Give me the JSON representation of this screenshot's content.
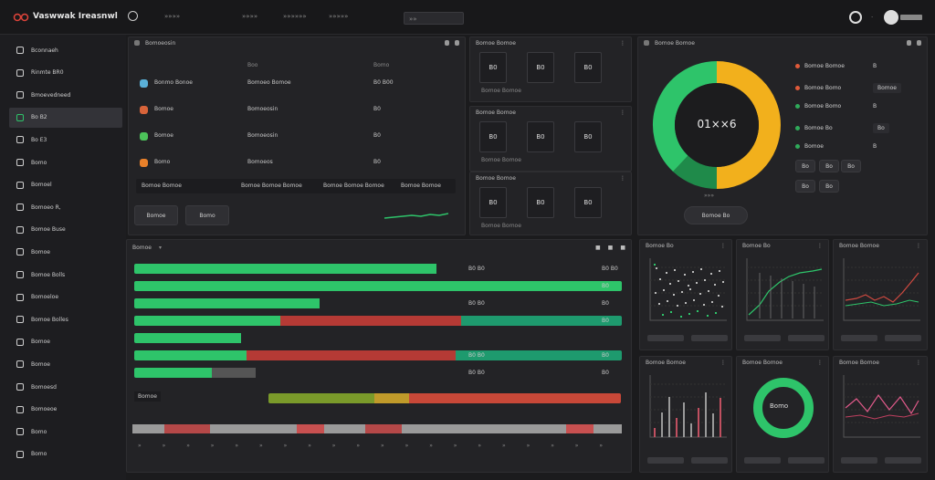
{
  "app": {
    "title": "Vaswwak Ireasnwl",
    "menu": [
      "»»»»",
      "»»»»",
      "»»»»»»",
      "»»»»»"
    ],
    "dropdown_value": "»»"
  },
  "sidebar": {
    "items": [
      {
        "label": "Bconnaeh",
        "icon": "grid-icon"
      },
      {
        "label": "Rinmte BR0",
        "icon": "monitor-icon"
      },
      {
        "label": "Bmoevedneed",
        "icon": "chip-icon"
      },
      {
        "label": "Bo B2",
        "icon": "database-icon",
        "active": true
      },
      {
        "label": "Bo E3",
        "icon": "chart-icon"
      },
      {
        "label": "Bomo",
        "icon": "cube-icon"
      },
      {
        "label": "Bomoel",
        "icon": "network-icon"
      },
      {
        "label": "Bomoeo R,",
        "icon": "file-icon"
      },
      {
        "label": "Bomoe Buse",
        "icon": "clock-icon"
      },
      {
        "label": "Bomoe",
        "icon": "stack-icon"
      },
      {
        "label": "Bomoe Bolls",
        "icon": "link-icon"
      },
      {
        "label": "Bomoeloe",
        "icon": "bell-icon"
      },
      {
        "label": "Bomoe Bolles",
        "icon": "list-icon"
      },
      {
        "label": "Bomoe",
        "icon": "folder-icon"
      },
      {
        "label": "Bomoe",
        "icon": "shield-icon"
      },
      {
        "label": "Bomoesd",
        "icon": "gear-icon"
      },
      {
        "label": "Bomoeoe",
        "icon": "user-icon"
      },
      {
        "label": "Bomo",
        "icon": "layers-icon"
      },
      {
        "label": "Bomo",
        "icon": "power-icon"
      }
    ]
  },
  "table_panel": {
    "title": "Bomoeosin",
    "columns": [
      "Boo",
      "Bomo"
    ],
    "rows": [
      {
        "name": "Bonmo Bonoe",
        "mid": "Bomoeo Bomoe",
        "val": "B0 B00",
        "color": "#5ab0d8"
      },
      {
        "name": "Bomoe",
        "mid": "Bomoeosin",
        "val": "B0",
        "color": "#d8643a"
      },
      {
        "name": "Bomoe",
        "mid": "Bomoeosin",
        "val": "B0",
        "color": "#4cc25a"
      },
      {
        "name": "Bomo",
        "mid": "Bomoeos",
        "val": "B0",
        "color": "#e8802a"
      }
    ],
    "footer": [
      "Bomoe Bomoe",
      "Bomoe Bomoe Bomoe",
      "Bomoe Bomoe Bomoe",
      "Bomoe Bomoe"
    ],
    "buttons": [
      "Bomoe",
      "Bomo"
    ]
  },
  "kpi_panels": [
    {
      "title": "Bomoe Bomoe",
      "values": [
        "B0",
        "B0",
        "B0"
      ],
      "footer": "Bomoe Bomoe"
    },
    {
      "title": "Bomoe Bomoe",
      "values": [
        "B0",
        "B0",
        "B0"
      ],
      "footer": "Bomoe Bomoe"
    },
    {
      "title": "Bomoe Bomoe",
      "values": [
        "B0",
        "B0",
        "B0"
      ],
      "footer": "Bomoe Bomoe"
    }
  ],
  "donut_panel": {
    "title": "Bomoe Bomoe",
    "center": "01××6",
    "below": "»»»",
    "button": "Bomoe Bo",
    "legend": [
      {
        "label": "Bomoe Bomoe",
        "val": "B",
        "color": "#e05a3a"
      },
      {
        "label": "Bomoe Bomo",
        "val": "Bomoe",
        "color": "#e05a3a"
      },
      {
        "label": "Bomoe Bomo",
        "val": "B",
        "color": "#2faa5a"
      },
      {
        "label": "Bomoe Bo",
        "val": "Bo",
        "color": "#2faa5a"
      },
      {
        "label": "Bomoe",
        "val": "B",
        "color": "#2faa5a"
      }
    ],
    "chips": [
      "Bo",
      "Bo",
      "Bo",
      "Bo",
      "Bo"
    ],
    "segments": [
      {
        "label": "Yellow",
        "value": 50,
        "color": "#f2b01c"
      },
      {
        "label": "Dark green",
        "value": 12,
        "color": "#1f8a4a"
      },
      {
        "label": "Green",
        "value": 38,
        "color": "#2ec46a"
      }
    ]
  },
  "progress_panel": {
    "title": "Bomoe",
    "header_buttons": [
      "■",
      "■",
      "■"
    ],
    "rows": [
      {
        "green": 0.62,
        "red": 0,
        "teal": 0,
        "gray": 0,
        "value": "B0 B0",
        "right": "B0 B0"
      },
      {
        "green": 1.0,
        "red": 0,
        "teal": 0,
        "gray": 0,
        "value": "",
        "right": "B0"
      },
      {
        "green": 0.38,
        "red": 0,
        "teal": 0,
        "gray": 0,
        "value": "B0 B0",
        "right": "B0"
      },
      {
        "green": 0.3,
        "red": 0.37,
        "teal": 0.33,
        "gray": 0,
        "value": "",
        "right": "B0"
      },
      {
        "green": 0.22,
        "red": 0,
        "teal": 0,
        "gray": 0,
        "value": "",
        "right": ""
      },
      {
        "green": 0.23,
        "red": 0.43,
        "teal": 0.34,
        "gray": 0,
        "value": "B0 B0",
        "right": "B0"
      },
      {
        "green": 0.16,
        "red": 0,
        "teal": 0,
        "gray": 0.09,
        "value": "B0 B0",
        "right": "B0"
      }
    ],
    "stack_label": "Bomoe",
    "ticks": [
      "»",
      "»",
      "»",
      "»",
      "»",
      "»",
      "»",
      "»",
      "»",
      "»",
      "»",
      "»",
      "»",
      "»",
      "»",
      "»",
      "»",
      "»",
      "»",
      "»"
    ]
  },
  "small_charts": [
    {
      "title": "Bomoe Bo",
      "kind": "scatter"
    },
    {
      "title": "Bomoe Bo",
      "kind": "line-green"
    },
    {
      "title": "Bomoe Bomoe",
      "kind": "line-red"
    },
    {
      "title": "Bomoe Bomoe",
      "kind": "bars"
    },
    {
      "title": "Bomoe Bomoe",
      "kind": "donut",
      "center": "Bomo"
    },
    {
      "title": "Bomoe Bomoe",
      "kind": "line-pink"
    }
  ],
  "colors": {
    "green": "#2ec46a",
    "red": "#b53a35",
    "teal": "#1e9a6e",
    "yellow": "#f2b01c",
    "bg": "#1b1b1d",
    "panel": "#232326"
  }
}
